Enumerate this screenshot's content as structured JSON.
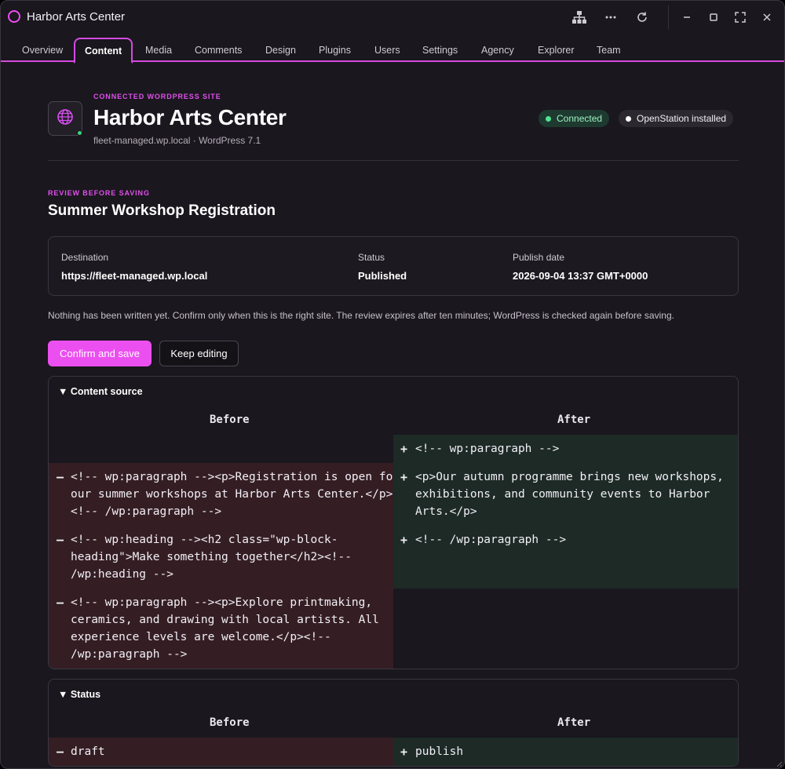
{
  "window": {
    "title": "Harbor Arts Center"
  },
  "titlebar_icons": [
    "sitemap-icon",
    "more-icon",
    "refresh-icon",
    "minimize-icon",
    "maximize-icon",
    "fullscreen-icon",
    "close-icon"
  ],
  "tabs": [
    {
      "label": "Overview"
    },
    {
      "label": "Content",
      "active": true
    },
    {
      "label": "Media"
    },
    {
      "label": "Comments"
    },
    {
      "label": "Design"
    },
    {
      "label": "Plugins"
    },
    {
      "label": "Users"
    },
    {
      "label": "Settings"
    },
    {
      "label": "Agency"
    },
    {
      "label": "Explorer"
    },
    {
      "label": "Team"
    }
  ],
  "site": {
    "eyebrow": "CONNECTED WORDPRESS SITE",
    "name": "Harbor Arts Center",
    "subtitle": "fleet-managed.wp.local · WordPress 7.1",
    "badges": {
      "connected": "Connected",
      "installed": "OpenStation installed"
    }
  },
  "review": {
    "eyebrow": "REVIEW BEFORE SAVING",
    "title": "Summer Workshop Registration",
    "summary": {
      "destination_label": "Destination",
      "destination_value": "https://fleet-managed.wp.local",
      "status_label": "Status",
      "status_value": "Published",
      "date_label": "Publish date",
      "date_value": "2026-09-04 13:37 GMT+0000"
    },
    "note": "Nothing has been written yet. Confirm only when this is the right site. The review expires after ten minutes; WordPress is checked again before saving.",
    "confirm_label": "Confirm and save",
    "keep_label": "Keep editing"
  },
  "content_diff": {
    "toggle": "▼ Content source",
    "before_label": "Before",
    "after_label": "After",
    "before_lines": [
      [
        "<!-- wp:paragraph --><p>Registration is open for",
        "our summer workshops at Harbor Arts Center.</p>",
        "<!-- /wp:paragraph -->"
      ],
      [
        "<!-- wp:heading --><h2 class=\"wp-block-",
        "heading\">Make something together</h2><!--",
        "/wp:heading -->"
      ],
      [
        "<!-- wp:paragraph --><p>Explore printmaking,",
        "ceramics, and drawing with local artists. All",
        "experience levels are welcome.</p><!--",
        "/wp:paragraph -->"
      ]
    ],
    "after_lines": [
      [
        "<!-- wp:paragraph -->"
      ],
      [
        "<p>Our autumn programme brings new workshops,",
        "exhibitions, and community events to Harbor",
        "Arts.</p>"
      ],
      [
        "<!-- /wp:paragraph -->"
      ]
    ],
    "del_mark": "–",
    "add_mark": "+"
  },
  "status_diff": {
    "toggle": "▼ Status",
    "before_label": "Before",
    "after_label": "After",
    "before_value": "draft",
    "after_value": "publish",
    "del_mark": "–",
    "add_mark": "+"
  }
}
